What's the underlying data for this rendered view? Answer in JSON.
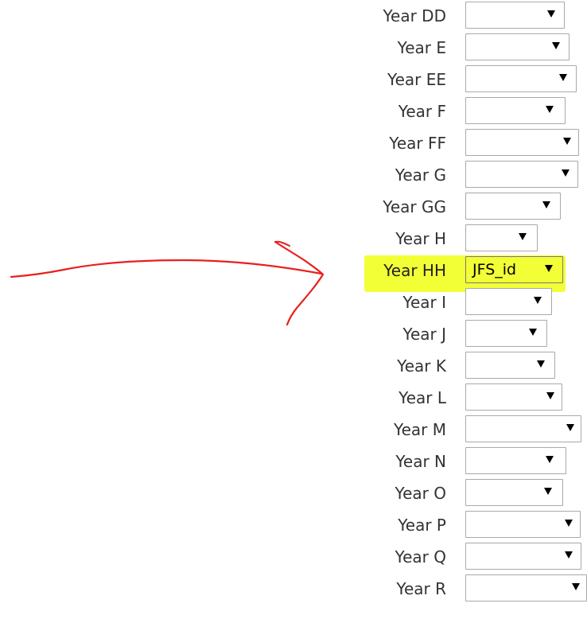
{
  "colors": {
    "highlight": "#f2ff36",
    "arrow": "#e8201f",
    "label": "#333333",
    "select_border": "#a9a9a9"
  },
  "form": {
    "rows": [
      {
        "label": "Year DD",
        "value": ""
      },
      {
        "label": "Year E",
        "value": ""
      },
      {
        "label": "Year EE",
        "value": ""
      },
      {
        "label": "Year F",
        "value": ""
      },
      {
        "label": "Year FF",
        "value": ""
      },
      {
        "label": "Year G",
        "value": ""
      },
      {
        "label": "Year GG",
        "value": ""
      },
      {
        "label": "Year H",
        "value": ""
      },
      {
        "label": "Year HH",
        "value": "JFS_id",
        "highlighted": true
      },
      {
        "label": "Year I",
        "value": ""
      },
      {
        "label": "Year J",
        "value": ""
      },
      {
        "label": "Year K",
        "value": ""
      },
      {
        "label": "Year L",
        "value": ""
      },
      {
        "label": "Year M",
        "value": ""
      },
      {
        "label": "Year N",
        "value": ""
      },
      {
        "label": "Year O",
        "value": ""
      },
      {
        "label": "Year P",
        "value": ""
      },
      {
        "label": "Year Q",
        "value": ""
      },
      {
        "label": "Year R",
        "value": ""
      }
    ]
  },
  "annotation": {
    "icon": "hand-drawn-arrow-icon"
  }
}
